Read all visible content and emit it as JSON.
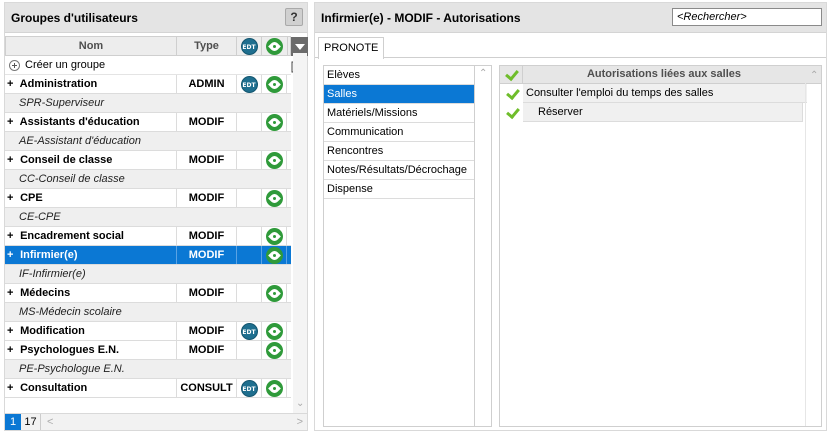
{
  "left_panel": {
    "title": "Groupes d'utilisateurs",
    "help_label": "?",
    "columns": {
      "nom": "Nom",
      "type": "Type",
      "edt_icon_label": "EDT"
    },
    "create_label": "Créer un groupe",
    "groups": [
      {
        "name": "Administration",
        "type": "ADMIN",
        "edt": true,
        "pronote": true,
        "style": "white",
        "sub": "SPR-Superviseur"
      },
      {
        "name": "Assistants d'éducation",
        "type": "MODIF",
        "edt": false,
        "pronote": true,
        "style": "white",
        "sub": "AE-Assistant d'éducation"
      },
      {
        "name": "Conseil de classe",
        "type": "MODIF",
        "edt": false,
        "pronote": true,
        "style": "white",
        "sub": "CC-Conseil de classe"
      },
      {
        "name": "CPE",
        "type": "MODIF",
        "edt": false,
        "pronote": true,
        "style": "white",
        "sub": "CE-CPE"
      },
      {
        "name": "Encadrement social",
        "type": "MODIF",
        "edt": false,
        "pronote": true,
        "style": "white"
      },
      {
        "name": "Infirmier(e)",
        "type": "MODIF",
        "edt": false,
        "pronote": true,
        "style": "selected",
        "sub": "IF-Infirmier(e)"
      },
      {
        "name": "Médecins",
        "type": "MODIF",
        "edt": false,
        "pronote": true,
        "style": "white",
        "sub": "MS-Médecin scolaire"
      },
      {
        "name": "Modification",
        "type": "MODIF",
        "edt": true,
        "pronote": true,
        "style": "white"
      },
      {
        "name": "Psychologues E.N.",
        "type": "MODIF",
        "edt": false,
        "pronote": true,
        "style": "white",
        "sub": "PE-Psychologue E.N."
      },
      {
        "name": "Consultation",
        "type": "CONSULT",
        "edt": true,
        "pronote": true,
        "style": "white"
      }
    ],
    "pager": {
      "current": "1",
      "total": "17"
    }
  },
  "right_panel": {
    "title": "Infirmier(e) - MODIF - Autorisations",
    "search_placeholder": "<Rechercher>",
    "tab_label": "PRONOTE",
    "categories": [
      {
        "label": "Elèves",
        "selected": false
      },
      {
        "label": "Salles",
        "selected": true
      },
      {
        "label": "Matériels/Missions",
        "selected": false
      },
      {
        "label": "Communication",
        "selected": false
      },
      {
        "label": "Rencontres",
        "selected": false
      },
      {
        "label": "Notes/Résultats/Décrochage",
        "selected": false
      },
      {
        "label": "Dispense",
        "selected": false
      }
    ],
    "permissions_title": "Autorisations liées aux salles",
    "permissions": [
      {
        "label": "Consulter l'emploi du temps des salles",
        "checked": true
      },
      {
        "label": "Réserver",
        "checked": true
      }
    ]
  },
  "colors": {
    "selection": "#0b78d4",
    "check": "#6fbd2b",
    "pronote_icon": "#2f9a3a",
    "edt_icon": "#1f6f8f"
  },
  "icons": [
    "help-icon",
    "plus-circle-icon",
    "copy-icon",
    "edt-icon",
    "pronote-icon",
    "sort-dropdown-icon",
    "check-icon"
  ]
}
